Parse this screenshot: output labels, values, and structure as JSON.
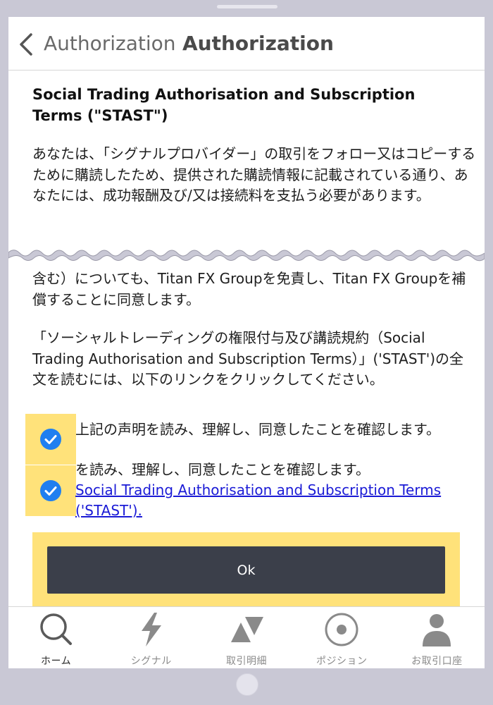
{
  "navbar": {
    "back_label": "Authorization",
    "title": "Authorization"
  },
  "content": {
    "terms_title": "Social Trading Authorisation and Subscription Terms (\"STAST\")",
    "paragraph_1": "あなたは、「シグナルプロバイダー」の取引をフォロー又はコピーするために購読したため、提供された購読情報に記載されている通り、あなたには、成功報酬及び/又は接続料を支払う必要があります。",
    "paragraph_2": "含む）についても、Titan FX Groupを免責し、Titan FX Groupを補償することに同意します。",
    "paragraph_3": "「ソーシャルトレーディングの権限付与及び講読規約（Social Trading Authorisation and Subscription Terms）」('STAST')の全文を読むには、以下のリンクをクリックしてください。"
  },
  "checkboxes": [
    {
      "label": "上記の声明を読み、理解し、同意したことを確認します。",
      "checked": true
    },
    {
      "prefix": "を読み、理解し、同意したことを確認します。",
      "link": "Social Trading Authorisation and Subscription Terms ('STAST').",
      "checked": true
    }
  ],
  "ok_button": {
    "label": "Ok"
  },
  "tabs": [
    {
      "label": "ホーム",
      "icon": "search-icon",
      "active": true
    },
    {
      "label": "シグナル",
      "icon": "lightning-icon",
      "active": false
    },
    {
      "label": "取引明細",
      "icon": "up-down-triangles-icon",
      "active": false
    },
    {
      "label": "ポジション",
      "icon": "target-icon",
      "active": false
    },
    {
      "label": "お取引口座",
      "icon": "person-icon",
      "active": false
    }
  ],
  "colors": {
    "highlight": "#ffe27a",
    "check_blue": "#1f7ff0",
    "button_dark": "#3b3f4a",
    "link_blue": "#1a1ad6",
    "device_frame": "#c9c8d5"
  }
}
